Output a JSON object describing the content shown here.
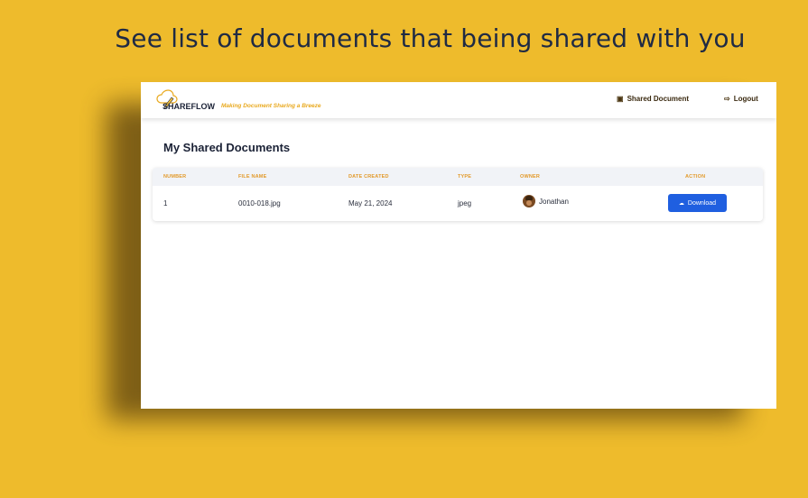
{
  "headline": "See list of documents that being shared with you",
  "navbar": {
    "brand": "SHAREFLOW",
    "tagline": "Making Document Sharing a Breeze",
    "links": [
      {
        "label": "Shared Document",
        "icon": "share-icon"
      },
      {
        "label": "Logout",
        "icon": "logout-icon"
      }
    ]
  },
  "page": {
    "title": "My Shared Documents"
  },
  "table": {
    "columns": [
      "NUMBER",
      "FILE NAME",
      "DATE CREATED",
      "TYPE",
      "OWNER",
      "ACTION"
    ],
    "rows": [
      {
        "number": "1",
        "file_name": "0010-018.jpg",
        "date_created": "May 21, 2024",
        "type": "jpeg",
        "owner": "Jonathan",
        "action": "Download"
      }
    ]
  },
  "colors": {
    "background": "#eebb2c",
    "accent": "#e9a91e",
    "button": "#1f5fe0"
  }
}
